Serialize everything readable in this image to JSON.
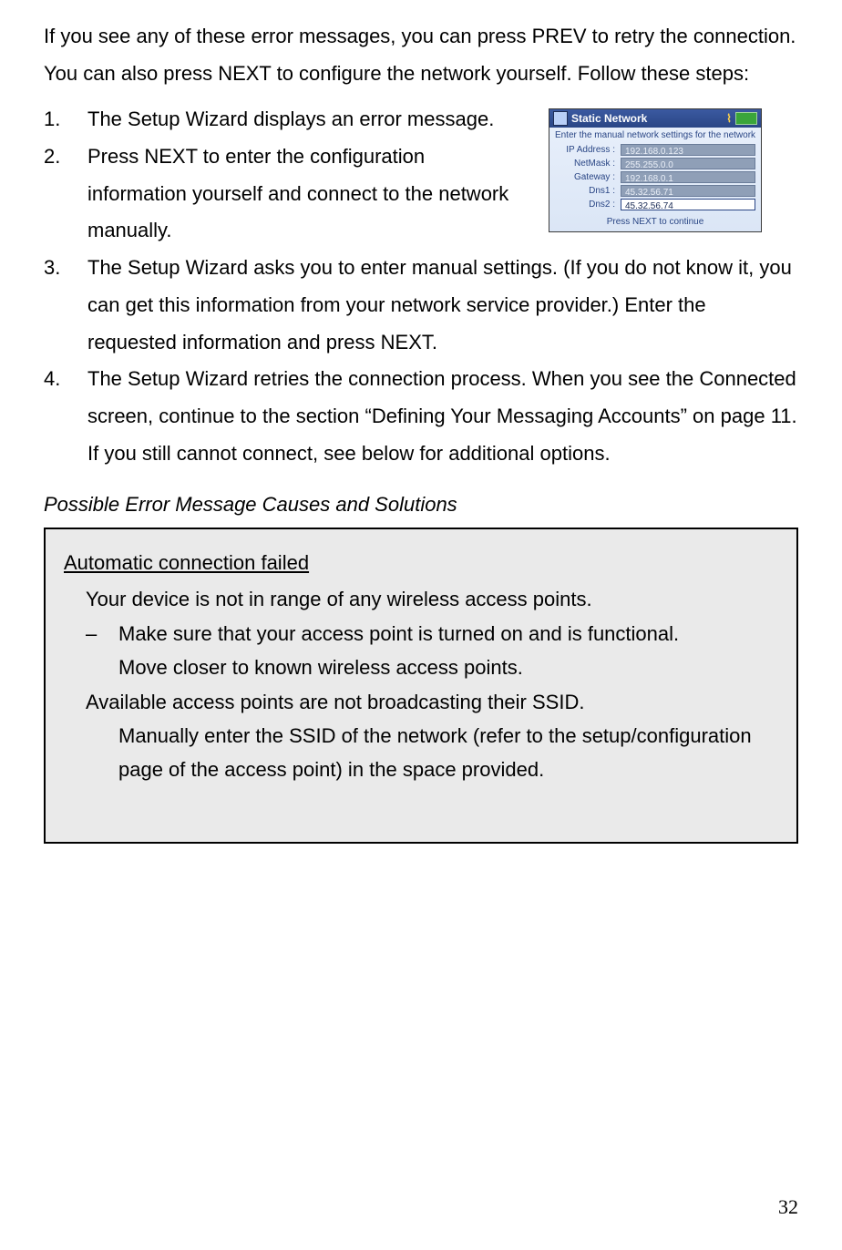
{
  "intro": "If you see any of these error messages, you can press PREV to retry the connection.   You can also press NEXT to configure the network yourself.   Follow these steps:",
  "steps": {
    "s1": "The Setup Wizard displays an error message.",
    "s2": "Press NEXT to enter the configuration information yourself and connect to the network manually.",
    "s3": "The Setup Wizard asks you to enter manual settings.   (If you do not know it, you can get this information from your network service provider.)   Enter the requested information and press NEXT.",
    "s4": "The Setup Wizard retries the connection process.   When you see the Connected screen, continue to the section “Defining Your Messaging Accounts” on page 11.   If you still cannot connect, see below for additional options."
  },
  "subheading": "Possible Error Message Causes and Solutions",
  "error_box": {
    "title": "Automatic connection failed",
    "cause1": "Your device is not in range of any wireless access points.",
    "sol1a": "Make sure that your access point is turned on and is functional.",
    "sol1b": "Move closer to known wireless access points.",
    "cause2": "Available access points are not broadcasting their SSID.",
    "sol2": "Manually enter the SSID of the network (refer to the setup/configuration page of the access point) in the space provided."
  },
  "device": {
    "title": "Static Network",
    "hint": "Enter the manual network settings for the network",
    "rows": {
      "r1": {
        "label": "IP Address :",
        "value": "192.168.0.123"
      },
      "r2": {
        "label": "NetMask :",
        "value": "255.255.0.0"
      },
      "r3": {
        "label": "Gateway :",
        "value": "192.168.0.1"
      },
      "r4": {
        "label": "Dns1 :",
        "value": "45.32.56.71"
      },
      "r5": {
        "label": "Dns2 :",
        "value": "45.32.56.74"
      }
    },
    "foot": "Press NEXT to continue"
  },
  "page_number": "32"
}
